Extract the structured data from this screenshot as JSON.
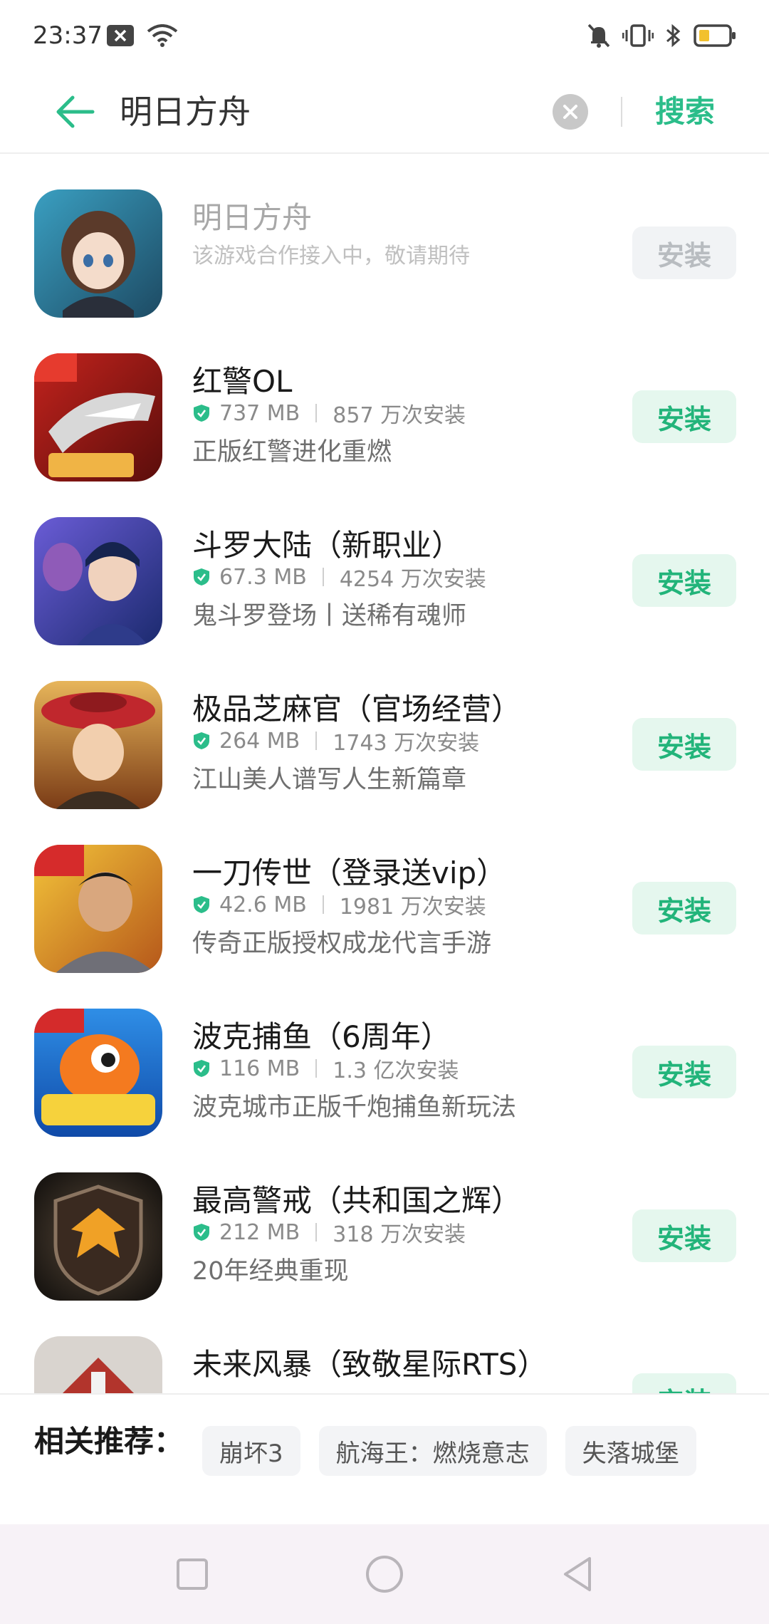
{
  "status_bar": {
    "time": "23:37"
  },
  "search": {
    "query": "明日方舟",
    "action_label": "搜索"
  },
  "apps": [
    {
      "name": "明日方舟",
      "description": "该游戏合作接入中，敬请期待",
      "install_label": "安装",
      "disabled": true
    },
    {
      "name": "红警OL",
      "size": "737 MB",
      "installs": "857 万次安装",
      "description": "正版红警进化重燃",
      "install_label": "安装"
    },
    {
      "name": "斗罗大陆（新职业）",
      "size": "67.3 MB",
      "installs": "4254 万次安装",
      "description": "鬼斗罗登场丨送稀有魂师",
      "install_label": "安装"
    },
    {
      "name": "极品芝麻官（官场经营）",
      "size": "264 MB",
      "installs": "1743 万次安装",
      "description": "江山美人谱写人生新篇章",
      "install_label": "安装"
    },
    {
      "name": "一刀传世（登录送vip）",
      "size": "42.6 MB",
      "installs": "1981 万次安装",
      "description": "传奇正版授权成龙代言手游",
      "install_label": "安装"
    },
    {
      "name": "波克捕鱼（6周年）",
      "size": "116 MB",
      "installs": "1.3 亿次安装",
      "description": "波克城市正版千炮捕鱼新玩法",
      "install_label": "安装"
    },
    {
      "name": "最高警戒（共和国之辉）",
      "size": "212 MB",
      "installs": "318 万次安装",
      "description": "20年经典重现",
      "install_label": "安装"
    },
    {
      "name": "未来风暴（致敬星际RTS）",
      "install_label": "安装"
    }
  ],
  "related": {
    "label": "相关推荐：",
    "tags": [
      "崩坏3",
      "航海王：燃烧意志",
      "失落城堡"
    ]
  },
  "colors": {
    "accent": "#2bbd8a",
    "install_bg": "#e5f7ee"
  }
}
